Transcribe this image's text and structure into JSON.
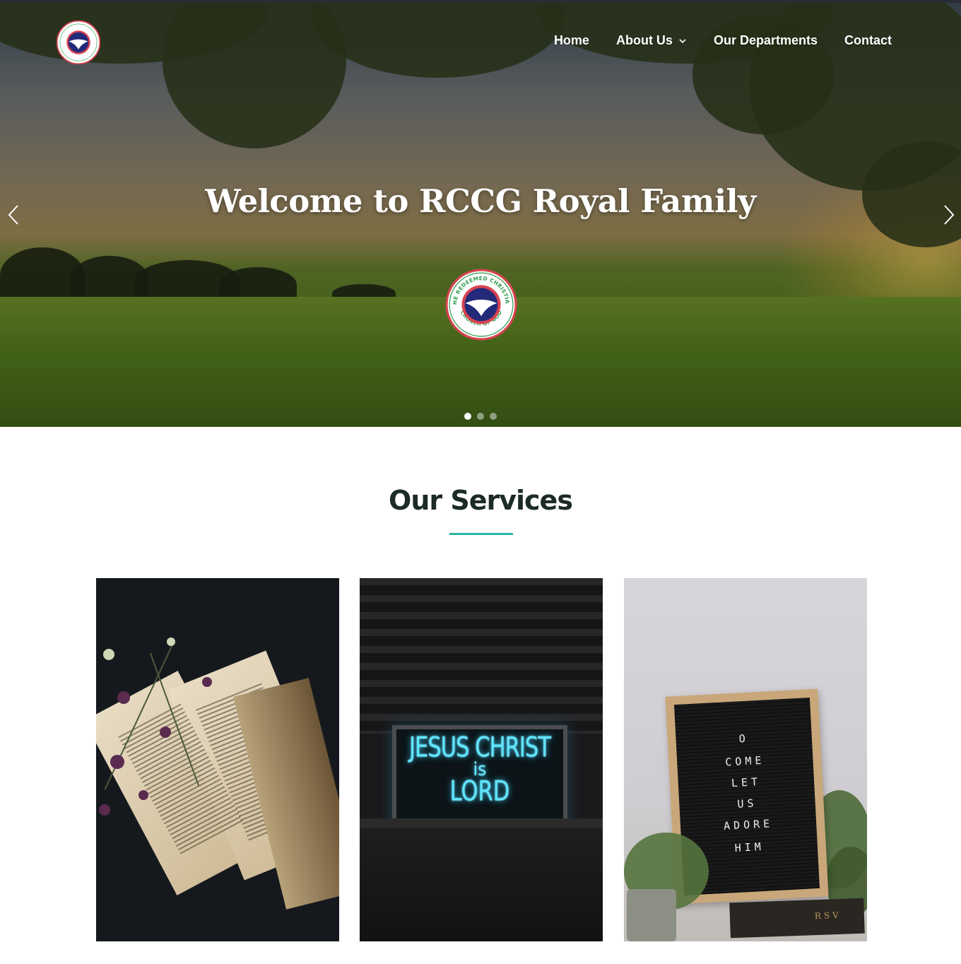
{
  "header": {
    "logo_name": "rccg-logo",
    "nav": [
      {
        "label": "Home"
      },
      {
        "label": "About Us",
        "has_dropdown": true
      },
      {
        "label": "Our Departments"
      },
      {
        "label": "Contact"
      }
    ]
  },
  "hero": {
    "title": "Welcome to RCCG Royal Family",
    "logo_text_top": "THE REDEEMED CHRISTIAN",
    "logo_text_bottom": "CHURCH OF GOD",
    "slides_total": 3,
    "active_slide": 1
  },
  "services": {
    "title": "Our Services",
    "accent_color": "#2bb5a3",
    "cards": [
      {
        "image": "open-bible-with-flowers"
      },
      {
        "image": "neon-sign",
        "sign_lines": [
          "JESUS CHRIST",
          "is",
          "LORD"
        ]
      },
      {
        "image": "letter-board",
        "board_lines": [
          "O",
          "COME",
          "LET",
          "US",
          "ADORE",
          "HIM"
        ],
        "book_label": "RSV"
      }
    ]
  }
}
